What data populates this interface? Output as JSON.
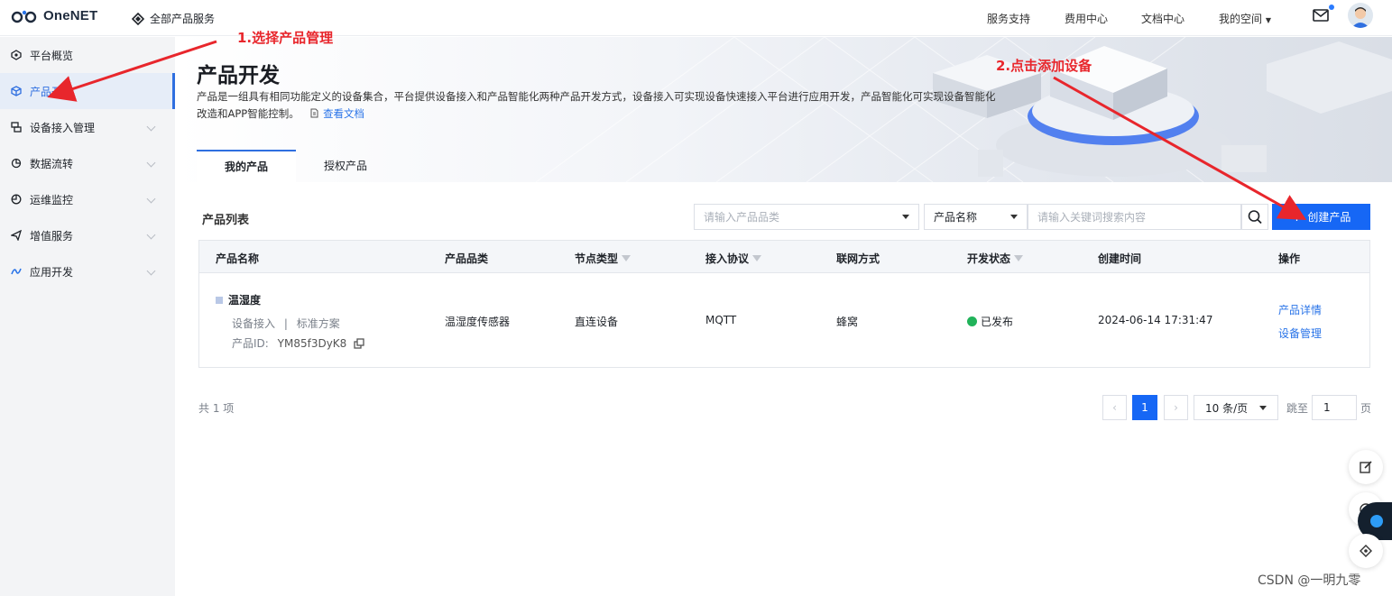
{
  "header": {
    "logo_text": "OneNET",
    "all_products": "全部产品服务",
    "nav": [
      "服务支持",
      "费用中心",
      "文档中心",
      "我的空间"
    ]
  },
  "sidebar": {
    "items": [
      {
        "label": "平台概览",
        "icon": "overview-icon"
      },
      {
        "label": "产品开发",
        "icon": "cube-icon",
        "active": true
      },
      {
        "label": "设备接入管理",
        "icon": "device-icon"
      },
      {
        "label": "数据流转",
        "icon": "data-flow-icon"
      },
      {
        "label": "运维监控",
        "icon": "monitor-icon"
      },
      {
        "label": "增值服务",
        "icon": "send-icon"
      },
      {
        "label": "应用开发",
        "icon": "app-dev-icon"
      }
    ]
  },
  "page": {
    "title": "产品开发",
    "desc_line1": "产品是一组具有相同功能定义的设备集合，平台提供设备接入和产品智能化两种产品开发方式，设备接入可实现设备快速接入平台进行应用开发，产品智能化可实现设备智能化",
    "desc_line2": "改造和APP智能控制。",
    "doc_link": "查看文档",
    "tabs": [
      "我的产品",
      "授权产品"
    ]
  },
  "toolbar": {
    "list_title": "产品列表",
    "category_placeholder": "请输入产品品类",
    "field_select": "产品名称",
    "keyword_placeholder": "请输入关键词搜索内容",
    "create_label": "创建产品"
  },
  "table": {
    "headers": [
      "产品名称",
      "产品品类",
      "节点类型",
      "接入协议",
      "联网方式",
      "开发状态",
      "创建时间",
      "操作"
    ],
    "rows": [
      {
        "name": "温湿度",
        "access": "设备接入",
        "sep": "|",
        "scheme": "标准方案",
        "id_label": "产品ID:",
        "id_value": "YM85f3DyK8",
        "category": "温湿度传感器",
        "node_type": "直连设备",
        "protocol": "MQTT",
        "network": "蜂窝",
        "status": "已发布",
        "created": "2024-06-14 17:31:47",
        "actions": [
          "产品详情",
          "设备管理"
        ]
      }
    ]
  },
  "pagination": {
    "total": "共 1 项",
    "current": "1",
    "page_size": "10 条/页",
    "jump_label": "跳至",
    "jump_value": "1",
    "page_suffix": "页"
  },
  "annotations": {
    "step1": "1.选择产品管理",
    "step2": "2.点击添加设备"
  },
  "watermark": "CSDN @一明九零",
  "colors": {
    "accent": "#1667f5",
    "annotation": "#e8262c",
    "success": "#21b35a"
  }
}
